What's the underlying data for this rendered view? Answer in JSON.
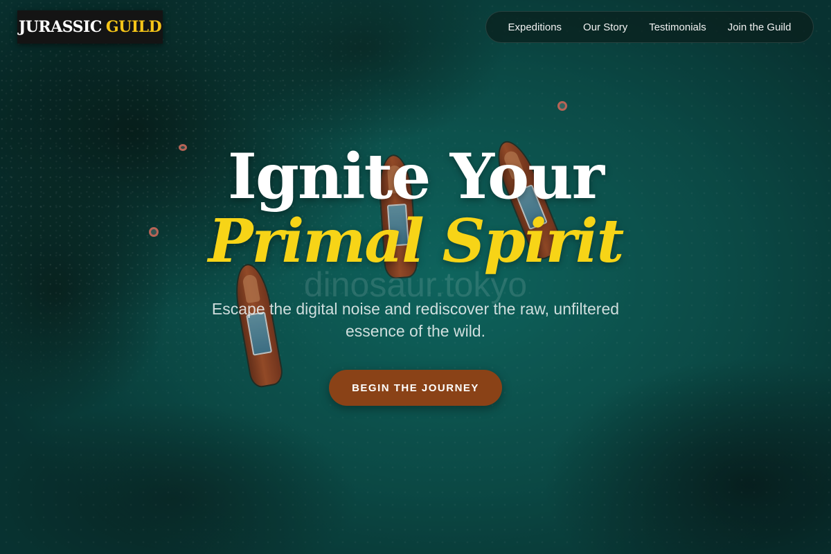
{
  "brand": {
    "name_part1": "JURASSIC",
    "name_part2": "GUILD"
  },
  "nav": {
    "items": [
      {
        "label": "Expeditions"
      },
      {
        "label": "Our Story"
      },
      {
        "label": "Testimonials"
      },
      {
        "label": "Join the Guild"
      }
    ]
  },
  "hero": {
    "title_line1": "Ignite Your",
    "title_line2": "Primal Spirit",
    "watermark": "dinosaur.tokyo",
    "subtitle": "Escape the digital noise and rediscover the raw, unfiltered essence of the wild.",
    "cta_label": "BEGIN THE JOURNEY"
  },
  "colors": {
    "accent_yellow": "#f7d417",
    "cta_brown": "#8a4217",
    "logo_bg": "#141414",
    "sea_teal": "#127a72"
  }
}
